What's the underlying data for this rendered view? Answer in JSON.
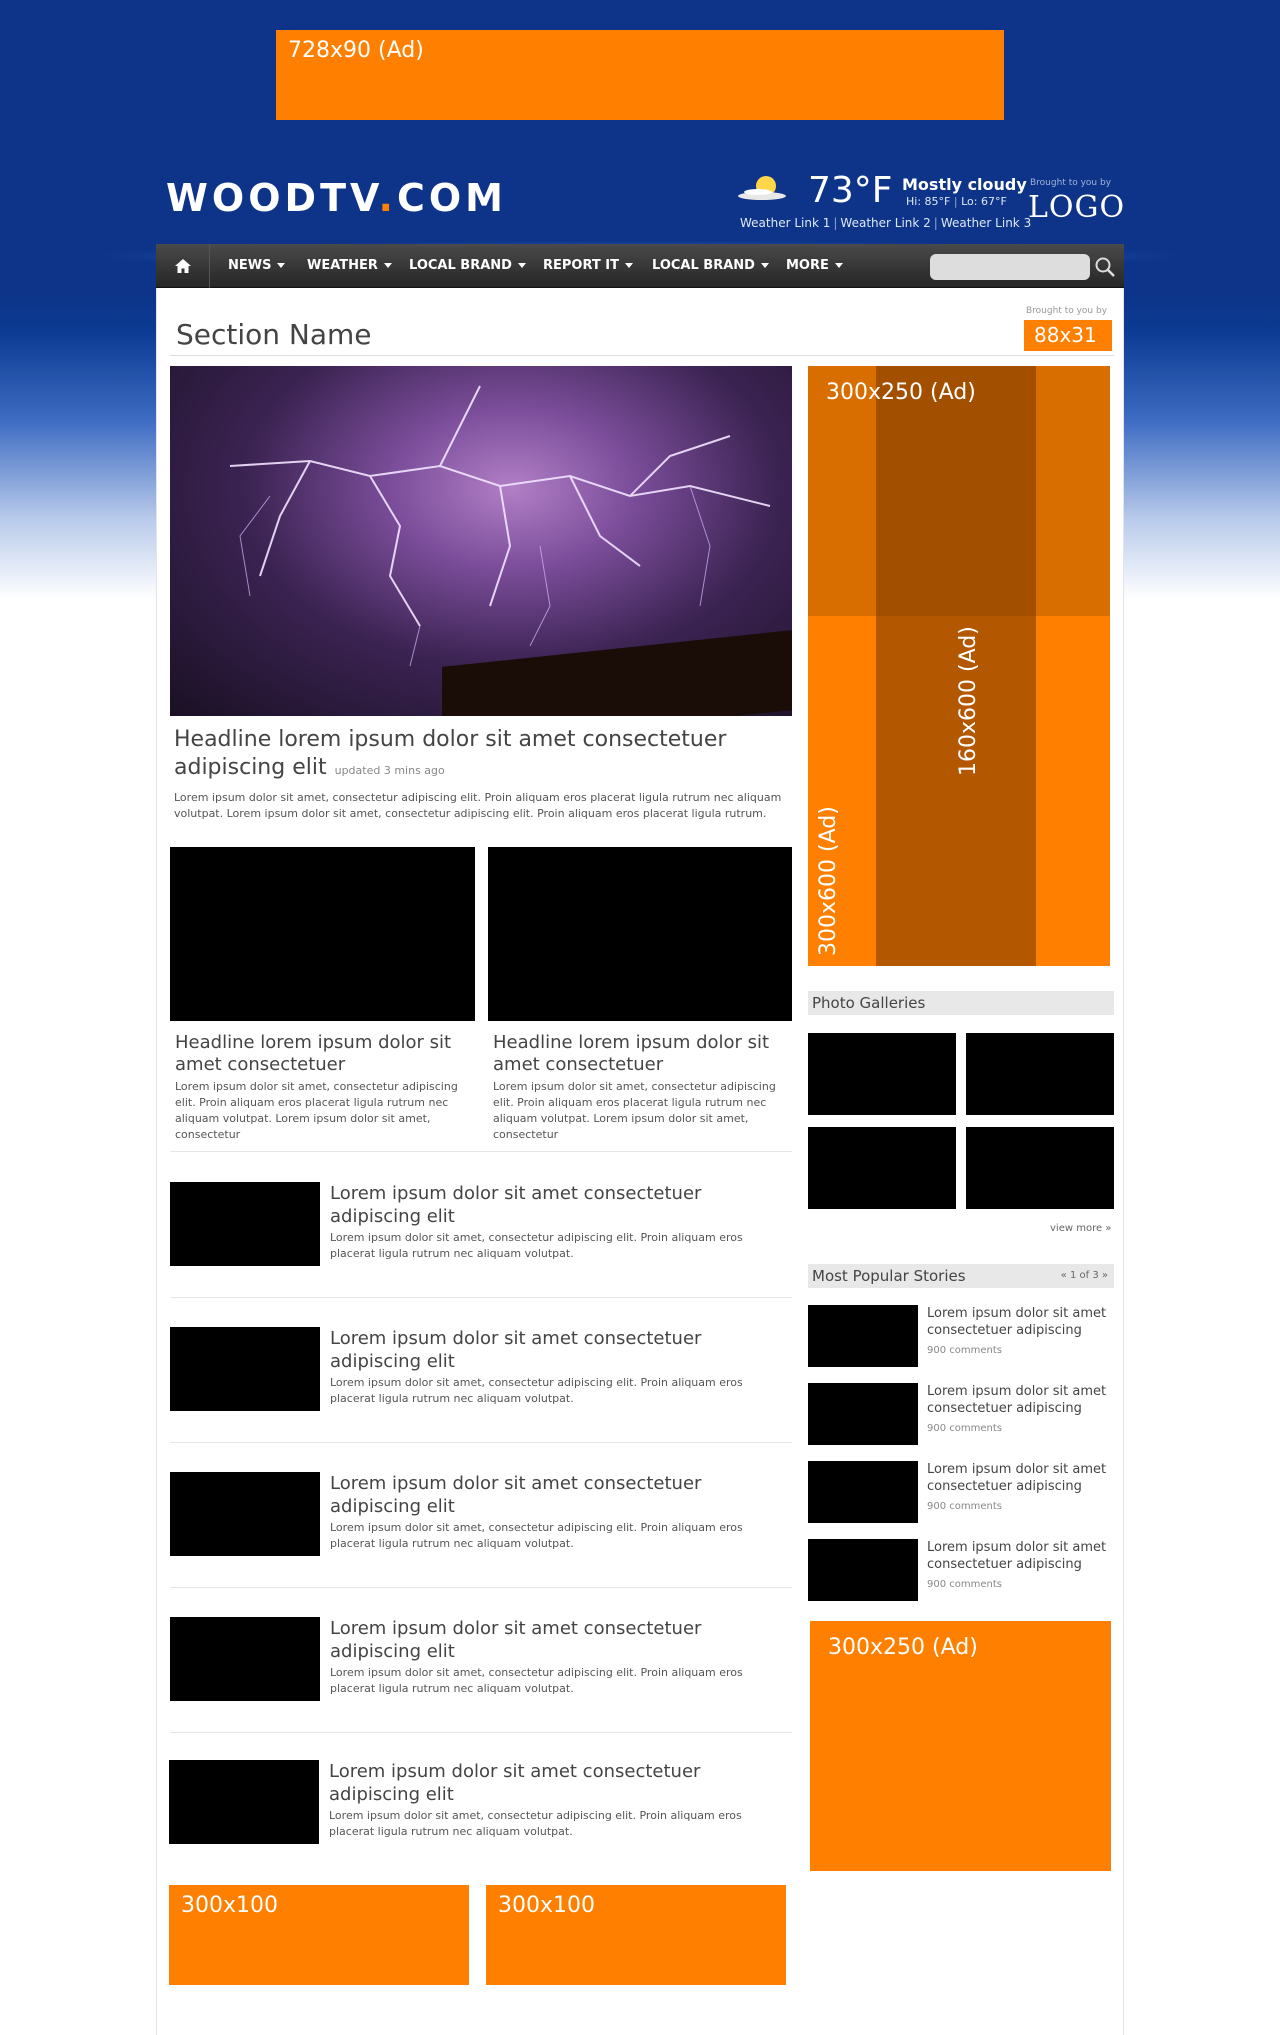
{
  "top_ad": {
    "label": "728x90 (Ad)"
  },
  "header": {
    "logo_main": "WOODTV",
    "logo_dot": ".",
    "logo_tld": "COM",
    "temperature": "73°F",
    "condition": "Mostly cloudy",
    "hi": "Hi: 85°F",
    "lo": "Lo: 67°F",
    "weather_links": [
      "Weather Link 1",
      "Weather Link 2",
      "Weather Link 3"
    ],
    "brought_by": "Brought to you by",
    "sponsor_logo": "LOGO"
  },
  "nav": {
    "items": [
      "NEWS",
      "WEATHER",
      "LOCAL BRAND",
      "REPORT IT",
      "LOCAL BRAND",
      "MORE"
    ],
    "search_placeholder": ""
  },
  "section": {
    "title": "Section Name",
    "brought_by": "Brought to you by",
    "ad_label": "88x31"
  },
  "hero": {
    "headline": "Headline lorem ipsum dolor sit amet consectetuer adipiscing elit",
    "updated": "updated 3 mins ago",
    "body": "Lorem ipsum dolor sit amet, consectetur adipiscing elit. Proin aliquam eros placerat ligula rutrum nec aliquam volutpat.  Lorem ipsum dolor sit amet, consectetur adipiscing elit. Proin aliquam eros placerat ligula rutrum."
  },
  "two_up": [
    {
      "headline": "Headline lorem ipsum dolor sit amet consectetuer",
      "body": "Lorem ipsum dolor sit amet, consectetur adipiscing elit. Proin aliquam eros placerat ligula rutrum nec aliquam volutpat.  Lorem ipsum dolor sit amet, consectetur"
    },
    {
      "headline": "Headline lorem ipsum dolor sit amet consectetuer",
      "body": "Lorem ipsum dolor sit amet, consectetur adipiscing elit. Proin aliquam eros placerat ligula rutrum nec aliquam volutpat.  Lorem ipsum dolor sit amet, consectetur"
    }
  ],
  "list_stories": [
    {
      "headline": "Lorem ipsum dolor sit amet consectetuer adipiscing elit",
      "body": "Lorem ipsum dolor sit amet, consectetur adipiscing elit. Proin aliquam eros placerat ligula rutrum nec aliquam volutpat."
    },
    {
      "headline": "Lorem ipsum dolor sit amet consectetuer adipiscing elit",
      "body": "Lorem ipsum dolor sit amet, consectetur adipiscing elit. Proin aliquam eros placerat ligula rutrum nec aliquam volutpat."
    },
    {
      "headline": "Lorem ipsum dolor sit amet consectetuer adipiscing elit",
      "body": "Lorem ipsum dolor sit amet, consectetur adipiscing elit. Proin aliquam eros placerat ligula rutrum nec aliquam volutpat."
    },
    {
      "headline": "Lorem ipsum dolor sit amet consectetuer adipiscing elit",
      "body": "Lorem ipsum dolor sit amet, consectetur adipiscing elit. Proin aliquam eros placerat ligula rutrum nec aliquam volutpat."
    },
    {
      "headline": "Lorem ipsum dolor sit amet consectetuer adipiscing elit",
      "body": "Lorem ipsum dolor sit amet, consectetur adipiscing elit. Proin aliquam eros placerat ligula rutrum nec aliquam volutpat."
    }
  ],
  "bottom_ads": [
    "300x100",
    "300x100"
  ],
  "right": {
    "ad_300x250": "300x250 (Ad)",
    "ad_160x600": "160x600 (Ad)",
    "ad_300x600": "300x600 (Ad)",
    "photo_galleries": "Photo Galleries",
    "view_more": "view more »",
    "most_popular": "Most Popular Stories",
    "pager": "«  1 of 3  »",
    "popular": [
      {
        "title": "Lorem ipsum dolor sit amet consectetuer adipiscing",
        "comments": "900 comments"
      },
      {
        "title": "Lorem ipsum dolor sit amet consectetuer adipiscing",
        "comments": "900 comments"
      },
      {
        "title": "Lorem ipsum dolor sit amet consectetuer adipiscing",
        "comments": "900 comments"
      },
      {
        "title": "Lorem ipsum dolor sit amet consectetuer adipiscing",
        "comments": "900 comments"
      }
    ],
    "bottom_ad": "300x250 (Ad)"
  },
  "colors": {
    "ad_orange": "#ff8000",
    "header_blue": "#0d3488",
    "nav_dark": "#333333"
  }
}
